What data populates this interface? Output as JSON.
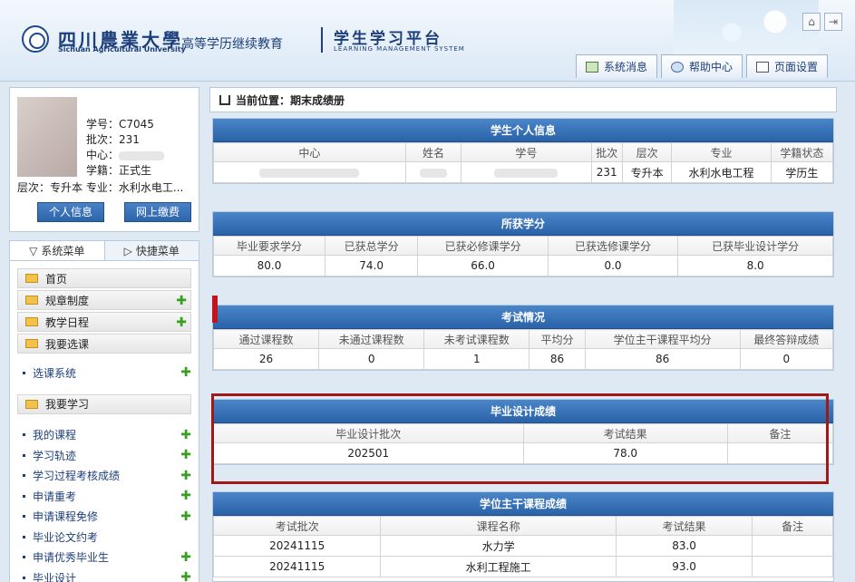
{
  "header": {
    "logo_cn": "四川農業大學",
    "logo_en": "Sichuan Agricultural University",
    "subtitle": "高等学历继续教育",
    "platform_title": "学生学习平台",
    "platform_subtitle": "LEARNING MANAGEMENT SYSTEM",
    "tabs": [
      {
        "label": "系统消息",
        "icon": "message-icon"
      },
      {
        "label": "帮助中心",
        "icon": "help-icon"
      },
      {
        "label": "页面设置",
        "icon": "settings-icon"
      }
    ]
  },
  "profile": {
    "student_id_label": "学号：C7045",
    "batch_label": "批次：231",
    "center_label": "中心：",
    "status_label": "学籍：正式生",
    "level_major_line": "层次：专升本  专业：水利水电工...",
    "btn_info": "个人信息",
    "btn_pay": "网上缴费"
  },
  "menu": {
    "tab_system": "系统菜单",
    "tab_quick": "快捷菜单",
    "items": [
      "首页",
      "规章制度",
      "教学日程",
      "我要选课"
    ],
    "select_course_sub": "选课系统",
    "study_section": "我要学习",
    "study_items": [
      "我的课程",
      "学习轨迹",
      "学习过程考核成绩",
      "申请重考",
      "申请课程免修",
      "毕业论文约考",
      "申请优秀毕业生",
      "毕业设计"
    ]
  },
  "breadcrumb": "当前位置：期末成绩册",
  "personal_info": {
    "title": "学生个人信息",
    "headers": [
      "中心",
      "姓名",
      "学号",
      "批次",
      "层次",
      "专业",
      "学籍状态"
    ],
    "row": [
      "",
      "",
      "C7045",
      "231",
      "专升本",
      "水利水电工程",
      "学历生"
    ]
  },
  "credits": {
    "title": "所获学分",
    "headers": [
      "毕业要求学分",
      "已获总学分",
      "已获必修课学分",
      "已获选修课学分",
      "已获毕业设计学分"
    ],
    "row": [
      "80.0",
      "74.0",
      "66.0",
      "0.0",
      "8.0"
    ]
  },
  "exam": {
    "title": "考试情况",
    "headers": [
      "通过课程数",
      "未通过课程数",
      "未考试课程数",
      "平均分",
      "学位主干课程平均分",
      "最终答辩成绩"
    ],
    "row": [
      "26",
      "0",
      "1",
      "86",
      "86",
      "0"
    ]
  },
  "graduation": {
    "title": "毕业设计成绩",
    "headers": [
      "毕业设计批次",
      "考试结果",
      "备注"
    ],
    "row": [
      "202501",
      "78.0",
      ""
    ]
  },
  "degree": {
    "title": "学位主干课程成绩",
    "headers": [
      "考试批次",
      "课程名称",
      "考试结果",
      "备注"
    ],
    "rows": [
      [
        "20241115",
        "水力学",
        "83.0",
        ""
      ],
      [
        "20241115",
        "水利工程施工",
        "93.0",
        ""
      ]
    ]
  }
}
